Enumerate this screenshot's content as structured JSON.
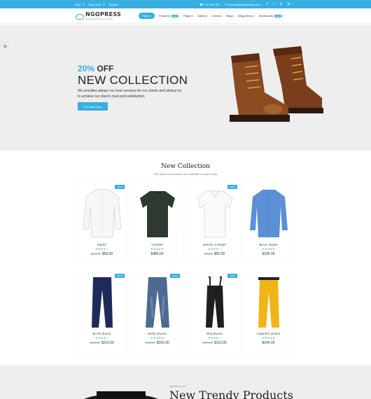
{
  "topbar": {
    "links": [
      "FAQ",
      "Help Desk",
      "Support"
    ],
    "phone": "123 456 789",
    "email": "contact@yourdomain.com"
  },
  "header": {
    "brand": "NGOPRESS",
    "tagline": "Wedding & Events in the Templates",
    "nav": [
      {
        "label": "Home",
        "active": true,
        "dropdown": true
      },
      {
        "label": "Features",
        "badge": "Hot",
        "dropdown": true
      },
      {
        "label": "Pages",
        "dropdown": true
      },
      {
        "label": "Gallery",
        "dropdown": true
      },
      {
        "label": "events",
        "dropdown": true
      },
      {
        "label": "Blog",
        "dropdown": true
      },
      {
        "label": "Mega Menu",
        "dropdown": true
      },
      {
        "label": "Shortcodes",
        "badge": "New",
        "dropdown": true
      }
    ]
  },
  "hero": {
    "offer_pct": "20%",
    "offer_label": "OFF",
    "title": "NEW COLLECTION",
    "desc": "We provides always our best services for our clients and always try to achieve our client's trust and satisfaction.",
    "button": "Purchase Now"
  },
  "collection": {
    "title": "New Collection",
    "subtitle": "See what new products are available in online shop",
    "sale_label": "SALE",
    "products": [
      {
        "name": "SHIRT",
        "old": "$110.00",
        "price": "$90.00",
        "sale": true,
        "rating": 4
      },
      {
        "name": "T-SHIRT",
        "old": "",
        "price": "$480.00",
        "sale": false,
        "rating": 5
      },
      {
        "name": "WHITE T-SHIRT",
        "old": "$70.00",
        "price": "$55.00",
        "sale": true,
        "rating": 4
      },
      {
        "name": "BLUE SHIRT",
        "old": "",
        "price": "$185.00",
        "sale": false,
        "rating": 5
      },
      {
        "name": "BLUE JEANS",
        "old": "$260.00",
        "price": "$210.00",
        "sale": true,
        "rating": 4
      },
      {
        "name": "FADE JEANS",
        "old": "$160.00",
        "price": "$150.00",
        "sale": true,
        "rating": 5
      },
      {
        "name": "BIB JEANS",
        "old": "$130.00",
        "price": "$110.00",
        "sale": true,
        "rating": 4
      },
      {
        "name": "GARDEN JEANS",
        "old": "",
        "price": "$240.00",
        "sale": false,
        "rating": 5
      }
    ]
  },
  "promo": {
    "tag": "Big discount!",
    "title": "New Trendy Products"
  },
  "colors": {
    "accent": "#39aee0",
    "hero_bg": "#eeeeee"
  }
}
